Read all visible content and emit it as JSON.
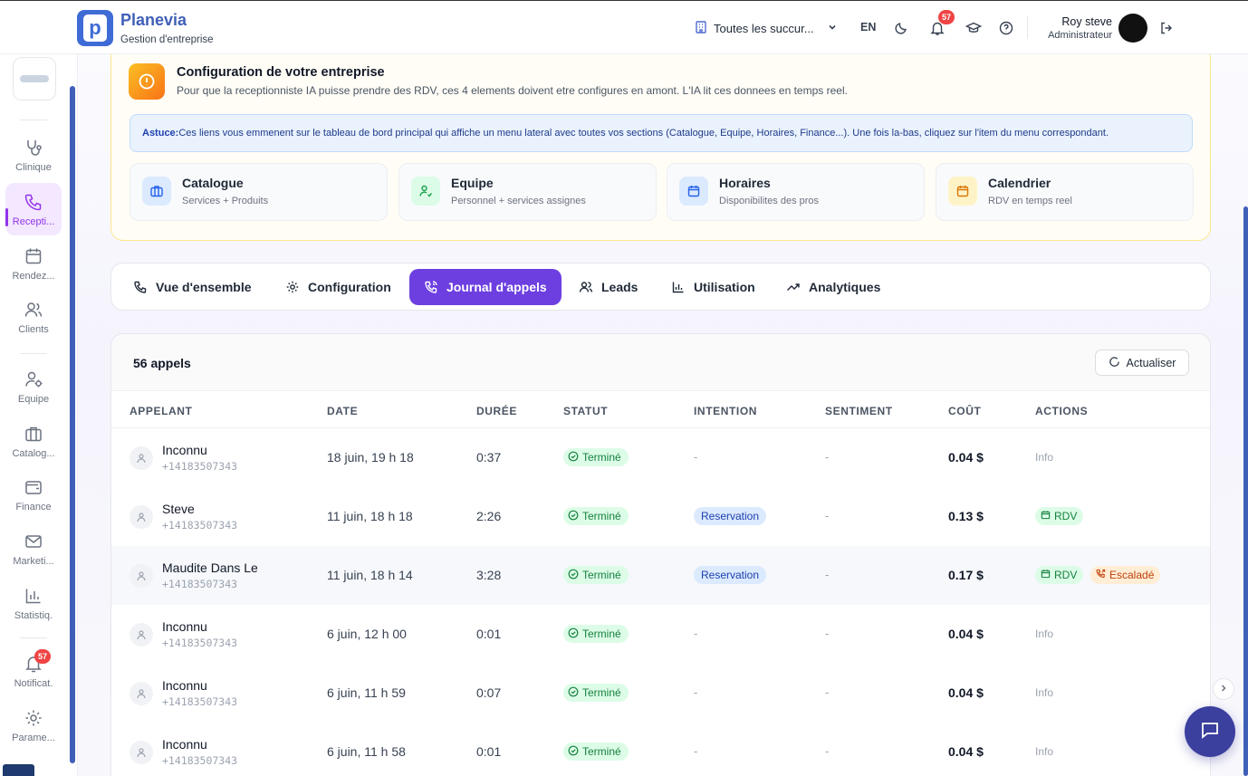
{
  "header": {
    "brand_name": "Planevia",
    "brand_sub": "Gestion d'entreprise",
    "branch_select": "Toutes les succur...",
    "language": "EN",
    "notifications_count": "57",
    "user_name": "Roy steve",
    "user_role": "Administrateur"
  },
  "sidebar": {
    "items": [
      {
        "label": "Clinique",
        "icon": "stethoscope-icon"
      },
      {
        "label": "Recepti...",
        "icon": "phone-icon"
      },
      {
        "label": "Rendez...",
        "icon": "calendar-icon"
      },
      {
        "label": "Clients",
        "icon": "users-icon"
      },
      {
        "label": "Equipe",
        "icon": "user-cog-icon"
      },
      {
        "label": "Catalog...",
        "icon": "briefcase-icon"
      },
      {
        "label": "Finance",
        "icon": "wallet-icon"
      },
      {
        "label": "Marketi...",
        "icon": "mail-icon"
      },
      {
        "label": "Statistiq.",
        "icon": "bar-chart-icon"
      },
      {
        "label": "Notificat.",
        "icon": "bell-icon"
      },
      {
        "label": "Parame...",
        "icon": "gear-icon"
      }
    ],
    "notif_badge": "57"
  },
  "config": {
    "title": "Configuration de votre entreprise",
    "description": "Pour que la receptionniste IA puisse prendre des RDV, ces 4 elements doivent etre configures en amont. L'IA lit ces donnees en temps reel.",
    "tip_label": "Astuce:",
    "tip_text": "Ces liens vous emmenent sur le tableau de bord principal qui affiche un menu lateral avec toutes vos sections (Catalogue, Equipe, Horaires, Finance...). Une fois la-bas, cliquez sur l'item du menu correspondant.",
    "modules": [
      {
        "title": "Catalogue",
        "subtitle": "Services + Produits",
        "color": "#dbeafe"
      },
      {
        "title": "Equipe",
        "subtitle": "Personnel + services assignes",
        "color": "#dcfce7"
      },
      {
        "title": "Horaires",
        "subtitle": "Disponibilites des pros",
        "color": "#dbeafe"
      },
      {
        "title": "Calendrier",
        "subtitle": "RDV en temps reel",
        "color": "#fef3c7"
      }
    ]
  },
  "tabs": [
    {
      "label": "Vue d'ensemble"
    },
    {
      "label": "Configuration"
    },
    {
      "label": "Journal d'appels",
      "active": true
    },
    {
      "label": "Leads"
    },
    {
      "label": "Utilisation"
    },
    {
      "label": "Analytiques"
    }
  ],
  "calls": {
    "count_label": "56 appels",
    "refresh_label": "Actualiser",
    "columns": [
      "APPELANT",
      "DATE",
      "DURÉE",
      "STATUT",
      "INTENTION",
      "SENTIMENT",
      "COÛT",
      "ACTIONS"
    ],
    "rows": [
      {
        "name": "Inconnu",
        "phone": "+14183507343",
        "date": "18 juin, 19 h 18",
        "duration": "0:37",
        "status": "Terminé",
        "intention": "-",
        "sentiment": "-",
        "cost": "0.04 $",
        "action": "Info"
      },
      {
        "name": "Steve",
        "phone": "+14183507343",
        "date": "11 juin, 18 h 18",
        "duration": "2:26",
        "status": "Terminé",
        "intention": "Reservation",
        "sentiment": "-",
        "cost": "0.13 $",
        "action_rdv": "RDV"
      },
      {
        "name": "Maudite Dans Le",
        "phone": "+14183507343",
        "date": "11 juin, 18 h 14",
        "duration": "3:28",
        "status": "Terminé",
        "intention": "Reservation",
        "sentiment": "-",
        "cost": "0.17 $",
        "action_rdv": "RDV",
        "action_escalade": "Escaladé"
      },
      {
        "name": "Inconnu",
        "phone": "+14183507343",
        "date": "6 juin, 12 h 00",
        "duration": "0:01",
        "status": "Terminé",
        "intention": "-",
        "sentiment": "-",
        "cost": "0.04 $",
        "action": "Info"
      },
      {
        "name": "Inconnu",
        "phone": "+14183507343",
        "date": "6 juin, 11 h 59",
        "duration": "0:07",
        "status": "Terminé",
        "intention": "-",
        "sentiment": "-",
        "cost": "0.04 $",
        "action": "Info"
      },
      {
        "name": "Inconnu",
        "phone": "+14183507343",
        "date": "6 juin, 11 h 58",
        "duration": "0:01",
        "status": "Terminé",
        "intention": "-",
        "sentiment": "-",
        "cost": "0.04 $",
        "action": "Info"
      }
    ]
  }
}
